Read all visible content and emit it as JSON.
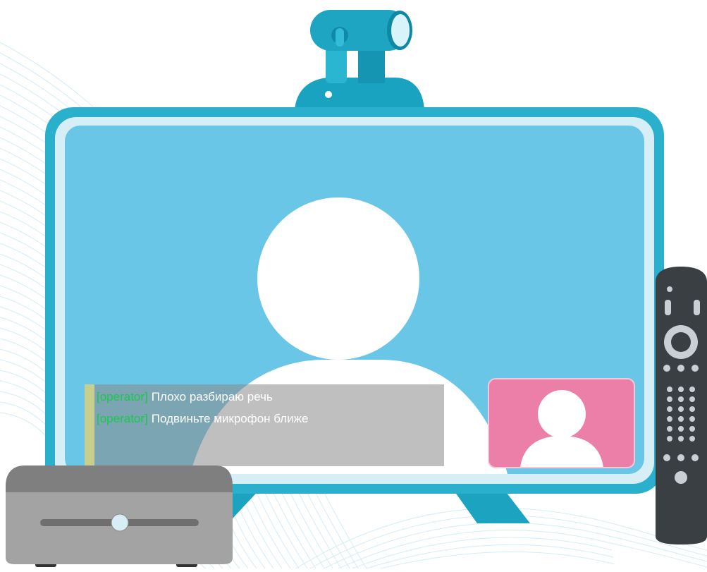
{
  "captions": [
    {
      "speaker": "[operator]",
      "text": "Плохо разбираю речь"
    },
    {
      "speaker": "[operator]",
      "text": "Подвиньте микрофон ближе"
    }
  ],
  "colors": {
    "tv_frame": "#2ab0cc",
    "tv_bezel_inner": "#d6eef6",
    "screen": "#6ac6e7",
    "camera_body": "#1da5c2",
    "camera_mount": "#21a8c3",
    "remote": "#3a3f44",
    "remote_buttons": "#c9cfd4",
    "settop_box": "#8e8e8e",
    "self_view": "#ec7fa8",
    "speaker_tag": "#19c84b",
    "subtitle_panel": "#a7a7a7"
  },
  "icons": {
    "camera": "webcam-icon",
    "remote": "remote-control-icon",
    "settop": "set-top-box-icon",
    "avatar": "user-avatar-icon"
  }
}
